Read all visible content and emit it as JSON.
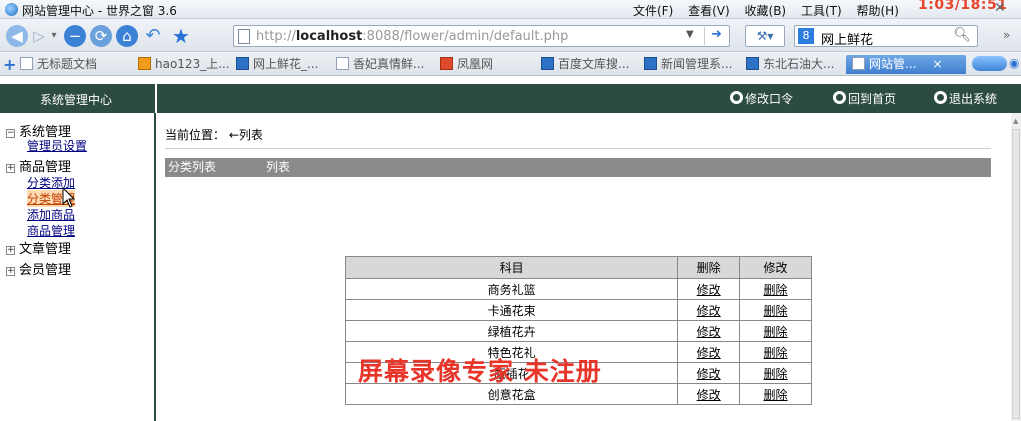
{
  "window": {
    "title": "网站管理中心 - 世界之窗 3.6",
    "menus": [
      "文件(F)",
      "查看(V)",
      "收藏(B)",
      "工具(T)",
      "帮助(H)"
    ],
    "clock": "1:03/18:51"
  },
  "navbar": {
    "url_prefix": "http://",
    "url_host": "localhost",
    "url_rest": ":8088/flower/admin/default.php",
    "search_text": "网上鲜花",
    "search_engine_icon": "8"
  },
  "tabs": [
    {
      "label": "无标题文档",
      "icon": "page"
    },
    {
      "label": "hao123_上...",
      "icon": "hao"
    },
    {
      "label": "网上鲜花_...",
      "icon": "blue"
    },
    {
      "label": "香妃真情鲜...",
      "icon": "page"
    },
    {
      "label": "凤凰网",
      "icon": "red"
    },
    {
      "label": "百度文库搜...",
      "icon": "blue"
    },
    {
      "label": "新闻管理系...",
      "icon": "blue"
    },
    {
      "label": "东北石油大...",
      "icon": "blue"
    },
    {
      "label": "网站管...",
      "icon": "page",
      "active": true
    }
  ],
  "header": {
    "brand": "系统管理中心",
    "change_password": "修改口令",
    "home": "回到首页",
    "logout": "退出系统"
  },
  "sidebar": {
    "groups": [
      {
        "label": "系统管理",
        "toggle": "⊟",
        "items": [
          "管理员设置"
        ]
      },
      {
        "label": "商品管理",
        "toggle": "⊞",
        "items": [
          "分类添加",
          "分类管理",
          "添加商品",
          "商品管理"
        ]
      },
      {
        "label": "文章管理",
        "toggle": "⊞",
        "items": []
      },
      {
        "label": "会员管理",
        "toggle": "⊞",
        "items": []
      }
    ]
  },
  "main": {
    "crumb_label": "当前位置：",
    "crumb_value": "←列表",
    "listbar": [
      "分类列表",
      "列表"
    ],
    "table": {
      "headers": [
        "科目",
        "删除",
        "修改"
      ],
      "rows": [
        {
          "name": "商务礼篮",
          "a": "修改",
          "b": "删除"
        },
        {
          "name": "卡通花束",
          "a": "修改",
          "b": "删除"
        },
        {
          "name": "绿植花卉",
          "a": "修改",
          "b": "删除"
        },
        {
          "name": "特色花礼",
          "a": "修改",
          "b": "删除"
        },
        {
          "name": "瓶插花",
          "a": "修改",
          "b": "删除"
        },
        {
          "name": "创意花盒",
          "a": "修改",
          "b": "删除"
        }
      ]
    },
    "watermark": "屏幕录像专家  未注册"
  },
  "colors": {
    "header_bg": "#2c4b43",
    "listbar_bg": "#8a8a8a",
    "watermark": "#e8352a"
  }
}
